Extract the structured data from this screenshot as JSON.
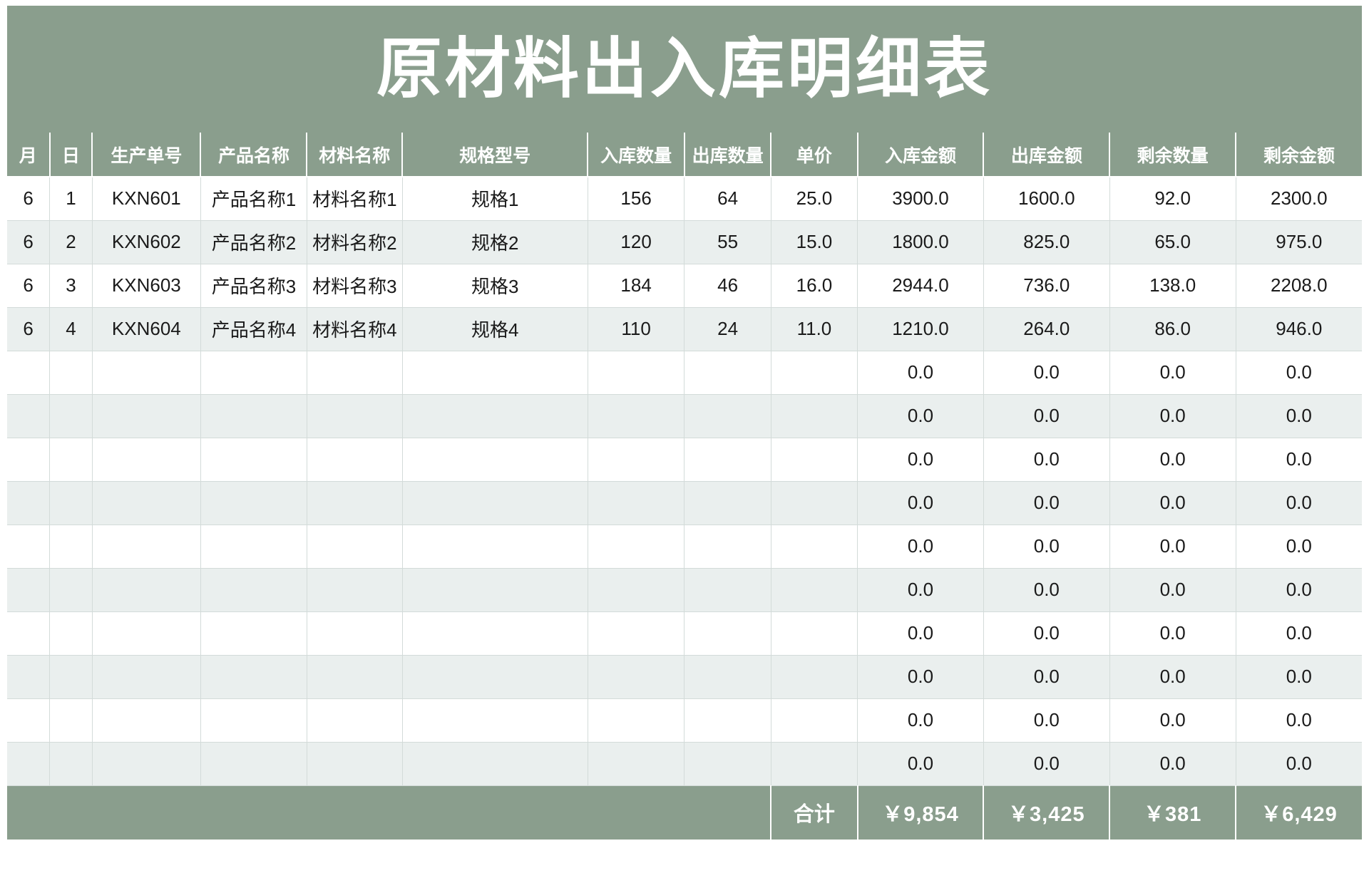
{
  "title": "原材料出入库明细表",
  "theme": {
    "header_green": "#8a9e8d",
    "row_alt": "#eaefee",
    "row_base": "#ffffff",
    "grid_line": "#d3dbd9",
    "header_text": "#ffffff",
    "body_text": "#1a1a1a"
  },
  "columns": [
    {
      "key": "month",
      "label": "月"
    },
    {
      "key": "day",
      "label": "日"
    },
    {
      "key": "order_no",
      "label": "生产单号"
    },
    {
      "key": "product",
      "label": "产品名称"
    },
    {
      "key": "material",
      "label": "材料名称"
    },
    {
      "key": "spec",
      "label": "规格型号"
    },
    {
      "key": "in_qty",
      "label": "入库数量"
    },
    {
      "key": "out_qty",
      "label": "出库数量"
    },
    {
      "key": "price",
      "label": "单价"
    },
    {
      "key": "in_amt",
      "label": "入库金额"
    },
    {
      "key": "out_amt",
      "label": "出库金额"
    },
    {
      "key": "left_qty",
      "label": "剩余数量"
    },
    {
      "key": "left_amt",
      "label": "剩余金额"
    }
  ],
  "rows": [
    {
      "month": "6",
      "day": "1",
      "order_no": "KXN601",
      "product": "产品名称1",
      "material": "材料名称1",
      "spec": "规格1",
      "in_qty": "156",
      "out_qty": "64",
      "price": "25.0",
      "in_amt": "3900.0",
      "out_amt": "1600.0",
      "left_qty": "92.0",
      "left_amt": "2300.0"
    },
    {
      "month": "6",
      "day": "2",
      "order_no": "KXN602",
      "product": "产品名称2",
      "material": "材料名称2",
      "spec": "规格2",
      "in_qty": "120",
      "out_qty": "55",
      "price": "15.0",
      "in_amt": "1800.0",
      "out_amt": "825.0",
      "left_qty": "65.0",
      "left_amt": "975.0"
    },
    {
      "month": "6",
      "day": "3",
      "order_no": "KXN603",
      "product": "产品名称3",
      "material": "材料名称3",
      "spec": "规格3",
      "in_qty": "184",
      "out_qty": "46",
      "price": "16.0",
      "in_amt": "2944.0",
      "out_amt": "736.0",
      "left_qty": "138.0",
      "left_amt": "2208.0"
    },
    {
      "month": "6",
      "day": "4",
      "order_no": "KXN604",
      "product": "产品名称4",
      "material": "材料名称4",
      "spec": "规格4",
      "in_qty": "110",
      "out_qty": "24",
      "price": "11.0",
      "in_amt": "1210.0",
      "out_amt": "264.0",
      "left_qty": "86.0",
      "left_amt": "946.0"
    },
    {
      "month": "",
      "day": "",
      "order_no": "",
      "product": "",
      "material": "",
      "spec": "",
      "in_qty": "",
      "out_qty": "",
      "price": "",
      "in_amt": "0.0",
      "out_amt": "0.0",
      "left_qty": "0.0",
      "left_amt": "0.0"
    },
    {
      "month": "",
      "day": "",
      "order_no": "",
      "product": "",
      "material": "",
      "spec": "",
      "in_qty": "",
      "out_qty": "",
      "price": "",
      "in_amt": "0.0",
      "out_amt": "0.0",
      "left_qty": "0.0",
      "left_amt": "0.0"
    },
    {
      "month": "",
      "day": "",
      "order_no": "",
      "product": "",
      "material": "",
      "spec": "",
      "in_qty": "",
      "out_qty": "",
      "price": "",
      "in_amt": "0.0",
      "out_amt": "0.0",
      "left_qty": "0.0",
      "left_amt": "0.0"
    },
    {
      "month": "",
      "day": "",
      "order_no": "",
      "product": "",
      "material": "",
      "spec": "",
      "in_qty": "",
      "out_qty": "",
      "price": "",
      "in_amt": "0.0",
      "out_amt": "0.0",
      "left_qty": "0.0",
      "left_amt": "0.0"
    },
    {
      "month": "",
      "day": "",
      "order_no": "",
      "product": "",
      "material": "",
      "spec": "",
      "in_qty": "",
      "out_qty": "",
      "price": "",
      "in_amt": "0.0",
      "out_amt": "0.0",
      "left_qty": "0.0",
      "left_amt": "0.0"
    },
    {
      "month": "",
      "day": "",
      "order_no": "",
      "product": "",
      "material": "",
      "spec": "",
      "in_qty": "",
      "out_qty": "",
      "price": "",
      "in_amt": "0.0",
      "out_amt": "0.0",
      "left_qty": "0.0",
      "left_amt": "0.0"
    },
    {
      "month": "",
      "day": "",
      "order_no": "",
      "product": "",
      "material": "",
      "spec": "",
      "in_qty": "",
      "out_qty": "",
      "price": "",
      "in_amt": "0.0",
      "out_amt": "0.0",
      "left_qty": "0.0",
      "left_amt": "0.0"
    },
    {
      "month": "",
      "day": "",
      "order_no": "",
      "product": "",
      "material": "",
      "spec": "",
      "in_qty": "",
      "out_qty": "",
      "price": "",
      "in_amt": "0.0",
      "out_amt": "0.0",
      "left_qty": "0.0",
      "left_amt": "0.0"
    },
    {
      "month": "",
      "day": "",
      "order_no": "",
      "product": "",
      "material": "",
      "spec": "",
      "in_qty": "",
      "out_qty": "",
      "price": "",
      "in_amt": "0.0",
      "out_amt": "0.0",
      "left_qty": "0.0",
      "left_amt": "0.0"
    },
    {
      "month": "",
      "day": "",
      "order_no": "",
      "product": "",
      "material": "",
      "spec": "",
      "in_qty": "",
      "out_qty": "",
      "price": "",
      "in_amt": "0.0",
      "out_amt": "0.0",
      "left_qty": "0.0",
      "left_amt": "0.0"
    }
  ],
  "total_row": {
    "label": "合计",
    "in_amt": "￥9,854",
    "out_amt": "￥3,425",
    "left_qty": "￥381",
    "left_amt": "￥6,429"
  }
}
